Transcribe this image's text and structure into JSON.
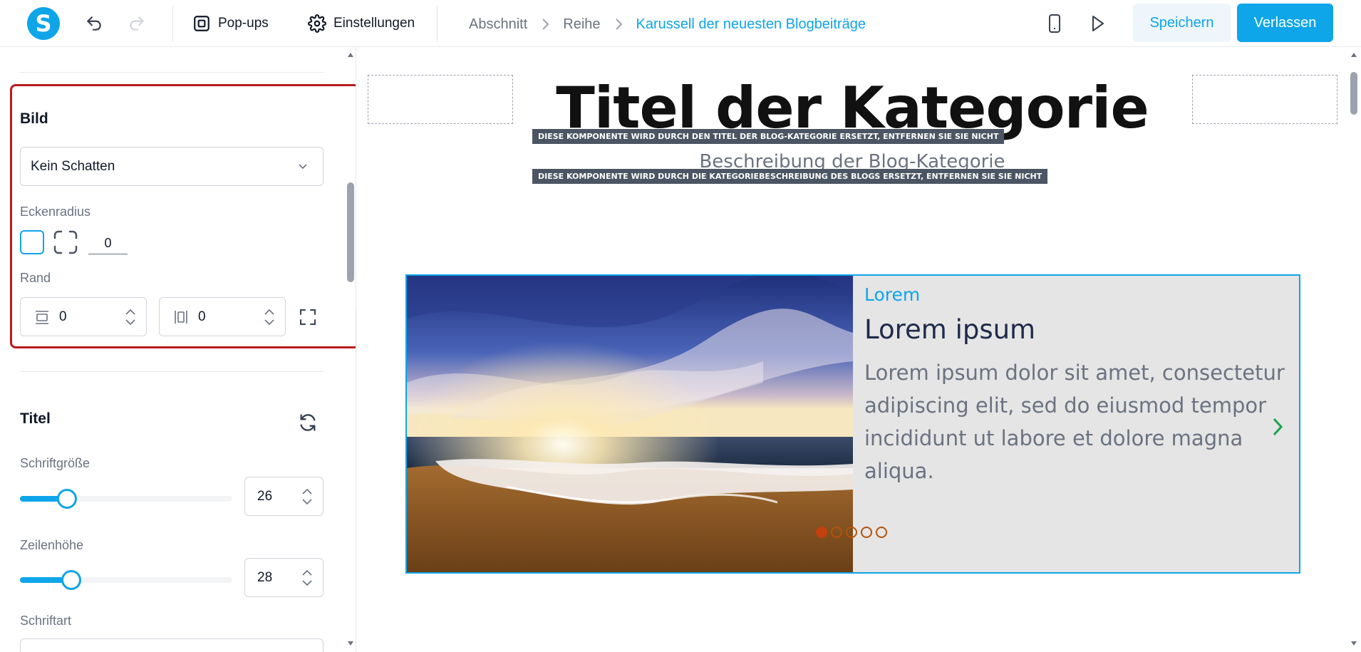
{
  "header": {
    "logo_letter": "S",
    "popups_label": "Pop-ups",
    "settings_label": "Einstellungen",
    "breadcrumb": [
      "Abschnitt",
      "Reihe",
      "Karussell der neuesten Blogbeiträge"
    ],
    "save_label": "Speichern",
    "exit_label": "Verlassen",
    "accent_color": "#0ea5e9"
  },
  "sidebar": {
    "image_section": {
      "title": "Bild",
      "shadow_select": "Kein Schatten",
      "corner_radius_label": "Eckenradius",
      "corner_radius_value": "0",
      "border_label": "Rand",
      "border_horizontal": "0",
      "border_vertical": "0"
    },
    "title_section": {
      "title": "Titel",
      "font_size_label": "Schriftgröße",
      "font_size_value": "26",
      "font_size_slider_fraction": 0.22,
      "line_height_label": "Zeilenhöhe",
      "line_height_value": "28",
      "line_height_slider_fraction": 0.24,
      "font_family_label": "Schriftart"
    }
  },
  "canvas": {
    "category_title": "Titel der Kategorie",
    "title_notice": "DIESE KOMPONENTE WIRD DURCH DEN TITEL DER BLOG-KATEGORIE ERSETZT, ENTFERNEN SIE SIE NICHT",
    "category_description": "Beschreibung der Blog-Kategorie",
    "description_notice": "DIESE KOMPONENTE WIRD DURCH DIE KATEGORIEBESCHREIBUNG DES BLOGS ERSETZT, ENTFERNEN SIE SIE NICHT",
    "card": {
      "category": "Lorem",
      "title": "Lorem ipsum",
      "body": "Lorem ipsum dolor sit amet, consectetur adipiscing elit, sed do eiusmod tempor incididunt ut labore et dolore magna aliqua."
    },
    "carousel_dots_total": 5,
    "carousel_active_dot": 1
  }
}
